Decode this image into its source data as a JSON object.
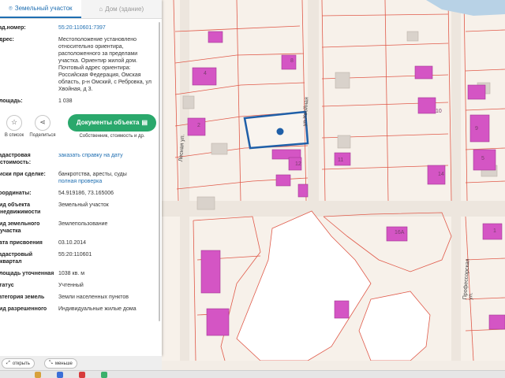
{
  "tabs": {
    "land": "Земельный участок",
    "house": "Дом (здание)"
  },
  "fields": [
    {
      "label": "Кад.номер:",
      "value": "55:20:110601:7397",
      "link": true
    },
    {
      "label": "Адрес:",
      "value": "Местоположение установлено относительно ориентира, расположенного за пределами участка. Ориентир жилой дом. Почтовый адрес ориентира: Российская Федерация, Омская область, р-н Омский, с Ребровка, ул Хвойная, д 3.",
      "link": false
    },
    {
      "label": "Площадь:",
      "value": "1 038",
      "link": false
    }
  ],
  "actions": {
    "list_label": "В список",
    "share_label": "Поделиться",
    "doc_button": "Документы объекта",
    "doc_sub": "Собственник, стоимость и др."
  },
  "fields2": [
    {
      "label": "Кадастровая стоимость:",
      "value": "заказать справку на дату",
      "link": true
    },
    {
      "label": "Риски при сделке:",
      "value": "банкротства, аресты, суды",
      "link": false,
      "extra": "полная проверка"
    },
    {
      "label": "Координаты:",
      "value": "54.919186, 73.165006",
      "link": false
    },
    {
      "label": "Вид объекта недвижимости",
      "value": "Земельный участок",
      "link": false
    },
    {
      "label": "Вид земельного участка",
      "value": "Землепользование",
      "link": false
    },
    {
      "label": "Дата присвоения",
      "value": "03.10.2014",
      "link": false
    },
    {
      "label": "Кадастровый квартал",
      "value": "55:20:110601",
      "link": false
    },
    {
      "label": "Площадь уточненная",
      "value": "1038 кв. м",
      "link": false
    },
    {
      "label": "Статус",
      "value": "Учтенный",
      "link": false
    },
    {
      "label": "Категория земель",
      "value": "Земли населенных пунктов",
      "link": false
    },
    {
      "label": "Вид разрешенного",
      "value": "Индивидуальные жилые дома",
      "link": false
    }
  ],
  "bottom": {
    "open_label": "открыть",
    "less_label": "меньше"
  },
  "map": {
    "streets": [
      "ул.Хвойная",
      "Лесная ул.",
      "Профессорская ул."
    ],
    "house_numbers": [
      "4",
      "8",
      "2",
      "10",
      "9",
      "5",
      "12",
      "11",
      "14",
      "16А",
      "1"
    ],
    "selected_color": "#1f5fa8",
    "building_color": "#d455c4",
    "boundary_color": "#e05a4a"
  },
  "icons": {
    "land": "pin-icon",
    "house": "house-icon",
    "star": "star-icon",
    "share": "share-icon",
    "doc": "document-icon"
  }
}
